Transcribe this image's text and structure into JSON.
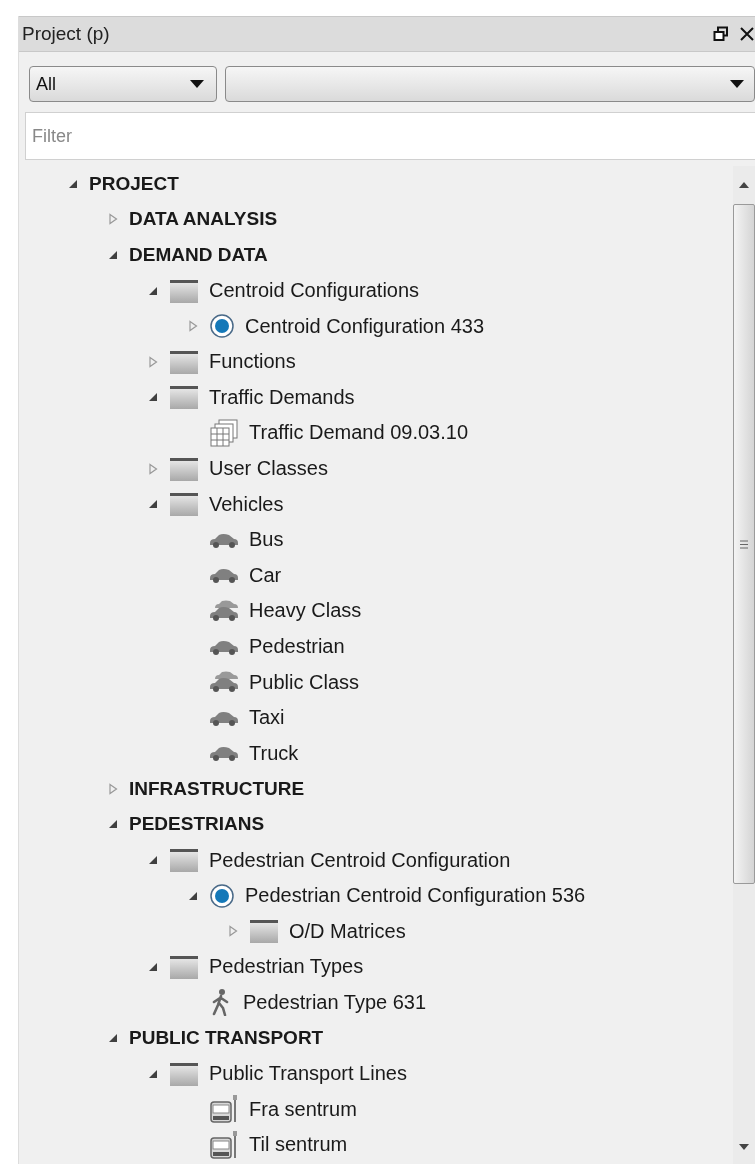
{
  "panel": {
    "title": "Project (p)"
  },
  "filters": {
    "type_dropdown": {
      "value": "All"
    },
    "filter_field": {
      "placeholder": "Filter"
    }
  },
  "tree": [
    {
      "label": "PROJECT",
      "expanded": true,
      "children": [
        {
          "label": "DATA ANALYSIS",
          "expanded": false
        },
        {
          "label": "DEMAND DATA",
          "expanded": true,
          "children": [
            {
              "label": "Centroid Configurations",
              "kind": "folder",
              "expanded": true,
              "children": [
                {
                  "label": "Centroid Configuration 433",
                  "kind": "radio",
                  "expanded": false
                }
              ]
            },
            {
              "label": "Functions",
              "kind": "folder",
              "expanded": false
            },
            {
              "label": "Traffic Demands",
              "kind": "folder",
              "expanded": true,
              "children": [
                {
                  "label": "Traffic Demand 09.03.10",
                  "kind": "grid"
                }
              ]
            },
            {
              "label": "User Classes",
              "kind": "folder",
              "expanded": false
            },
            {
              "label": "Vehicles",
              "kind": "folder",
              "expanded": true,
              "children": [
                {
                  "label": "Bus",
                  "kind": "car"
                },
                {
                  "label": "Car",
                  "kind": "car"
                },
                {
                  "label": "Heavy Class",
                  "kind": "cars"
                },
                {
                  "label": "Pedestrian",
                  "kind": "car"
                },
                {
                  "label": "Public Class",
                  "kind": "cars"
                },
                {
                  "label": "Taxi",
                  "kind": "car"
                },
                {
                  "label": "Truck",
                  "kind": "car"
                }
              ]
            }
          ]
        },
        {
          "label": "INFRASTRUCTURE",
          "expanded": false
        },
        {
          "label": "PEDESTRIANS",
          "expanded": true,
          "children": [
            {
              "label": "Pedestrian Centroid Configuration",
              "kind": "folder",
              "expanded": true,
              "children": [
                {
                  "label": "Pedestrian Centroid Configuration 536",
                  "kind": "radio",
                  "expanded": true,
                  "children": [
                    {
                      "label": "O/D Matrices",
                      "kind": "folder",
                      "expanded": false
                    }
                  ]
                }
              ]
            },
            {
              "label": "Pedestrian Types",
              "kind": "folder",
              "expanded": true,
              "children": [
                {
                  "label": "Pedestrian Type 631",
                  "kind": "walker"
                }
              ]
            }
          ]
        },
        {
          "label": "PUBLIC TRANSPORT",
          "expanded": true,
          "children": [
            {
              "label": "Public Transport Lines",
              "kind": "folder",
              "expanded": true,
              "children": [
                {
                  "label": "Fra sentrum",
                  "kind": "bus"
                },
                {
                  "label": "Til sentrum",
                  "kind": "bus"
                }
              ]
            }
          ]
        }
      ]
    }
  ]
}
